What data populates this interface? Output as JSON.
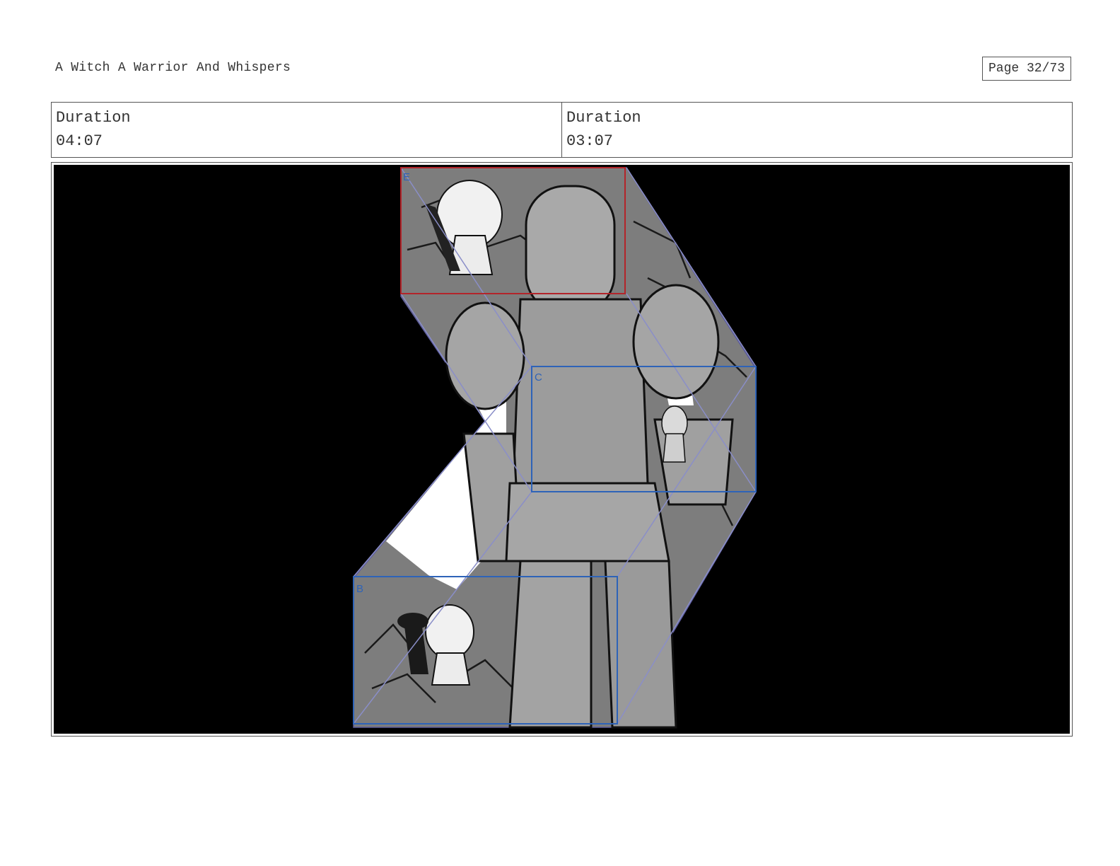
{
  "header": {
    "project_title": "A Witch A Warrior And Whispers",
    "page_indicator": "Page 32/73"
  },
  "durations": [
    {
      "label": "Duration",
      "value": "04:07"
    },
    {
      "label": "Duration",
      "value": "03:07"
    }
  ],
  "panel": {
    "frame_labels": {
      "top": "E",
      "middle": "C",
      "bottom": "B"
    },
    "colors": {
      "background": "#000000",
      "camera_frame_red": "#b3242a",
      "camera_frame_blue": "#2e63b8",
      "path_line": "#8a8ec8"
    }
  }
}
